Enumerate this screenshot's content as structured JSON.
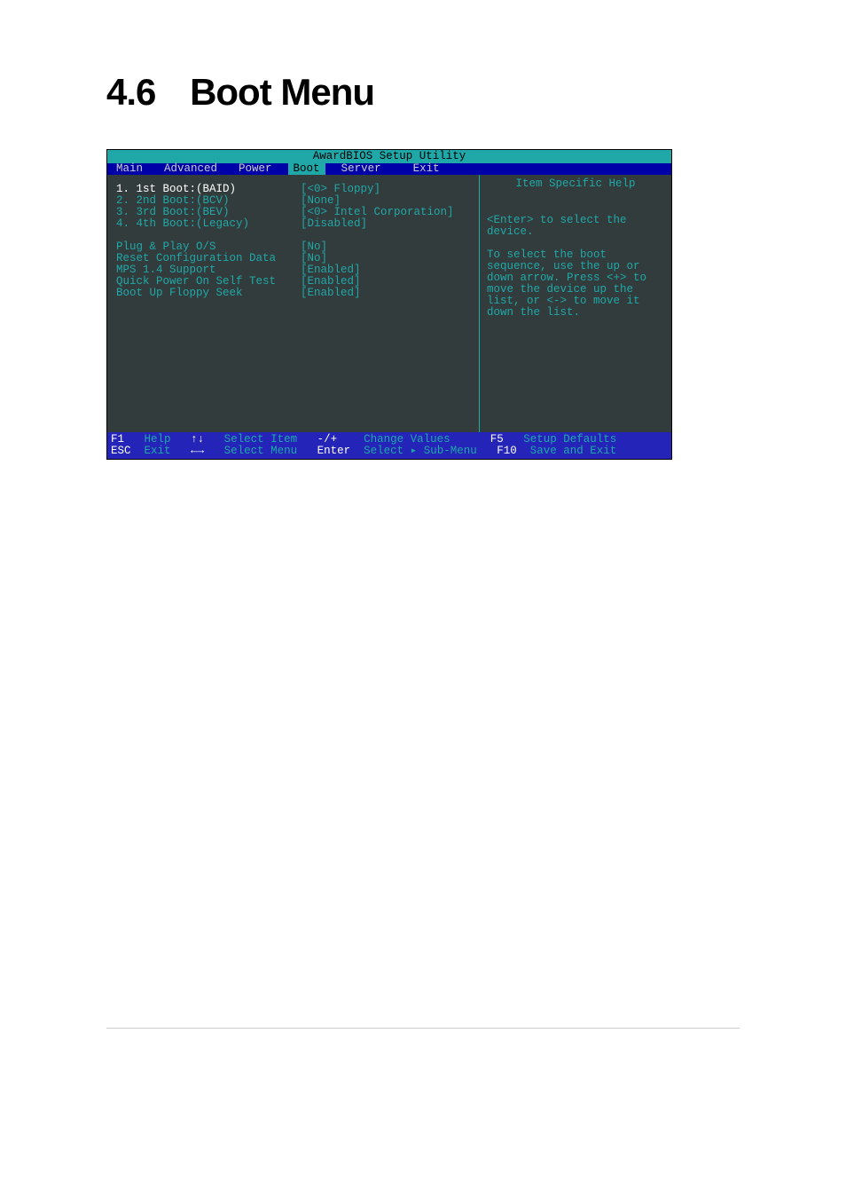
{
  "page": {
    "section_number": "4.6",
    "section_title": "Boot Menu"
  },
  "bios": {
    "title": "AwardBIOS Setup Utility",
    "menu": {
      "items": [
        "Main",
        "Advanced",
        "Power",
        "Boot",
        "Server",
        "Exit"
      ],
      "active": "Boot"
    },
    "settings": {
      "boot_order": [
        {
          "label": "1. 1st Boot:(BAID)",
          "value": "[<0> Floppy]"
        },
        {
          "label": "2. 2nd Boot:(BCV)",
          "value": "[None]"
        },
        {
          "label": "3. 3rd Boot:(BEV)",
          "value": "[<0> Intel Corporation]"
        },
        {
          "label": "4. 4th Boot:(Legacy)",
          "value": "[Disabled]"
        }
      ],
      "options": [
        {
          "label": "Plug & Play O/S",
          "value": "[No]"
        },
        {
          "label": "Reset Configuration Data",
          "value": "[No]"
        },
        {
          "label": "MPS 1.4 Support",
          "value": "[Enabled]"
        },
        {
          "label": "Quick Power On Self Test",
          "value": "[Enabled]"
        },
        {
          "label": "Boot Up Floppy Seek",
          "value": "[Enabled]"
        }
      ]
    },
    "help": {
      "title": "Item Specific Help",
      "body": "<Enter> to select the device.\n\nTo select the boot sequence, use the up or down arrow. Press <+> to move the device up the list, or <-> to move it down the list."
    },
    "footer": {
      "line1": {
        "k1": "F1",
        "a1": "Help",
        "k2": "↑↓",
        "a2": "Select Item",
        "k3": "-/+",
        "a3": "Change Values",
        "k4": "F5",
        "a4": "Setup Defaults"
      },
      "line2": {
        "k1": "ESC",
        "a1": "Exit",
        "k2": "←→",
        "a2": "Select Menu",
        "k3": "Enter",
        "a3": "Select ▸ Sub-Menu",
        "k4": "F10",
        "a4": "Save and Exit"
      }
    }
  }
}
